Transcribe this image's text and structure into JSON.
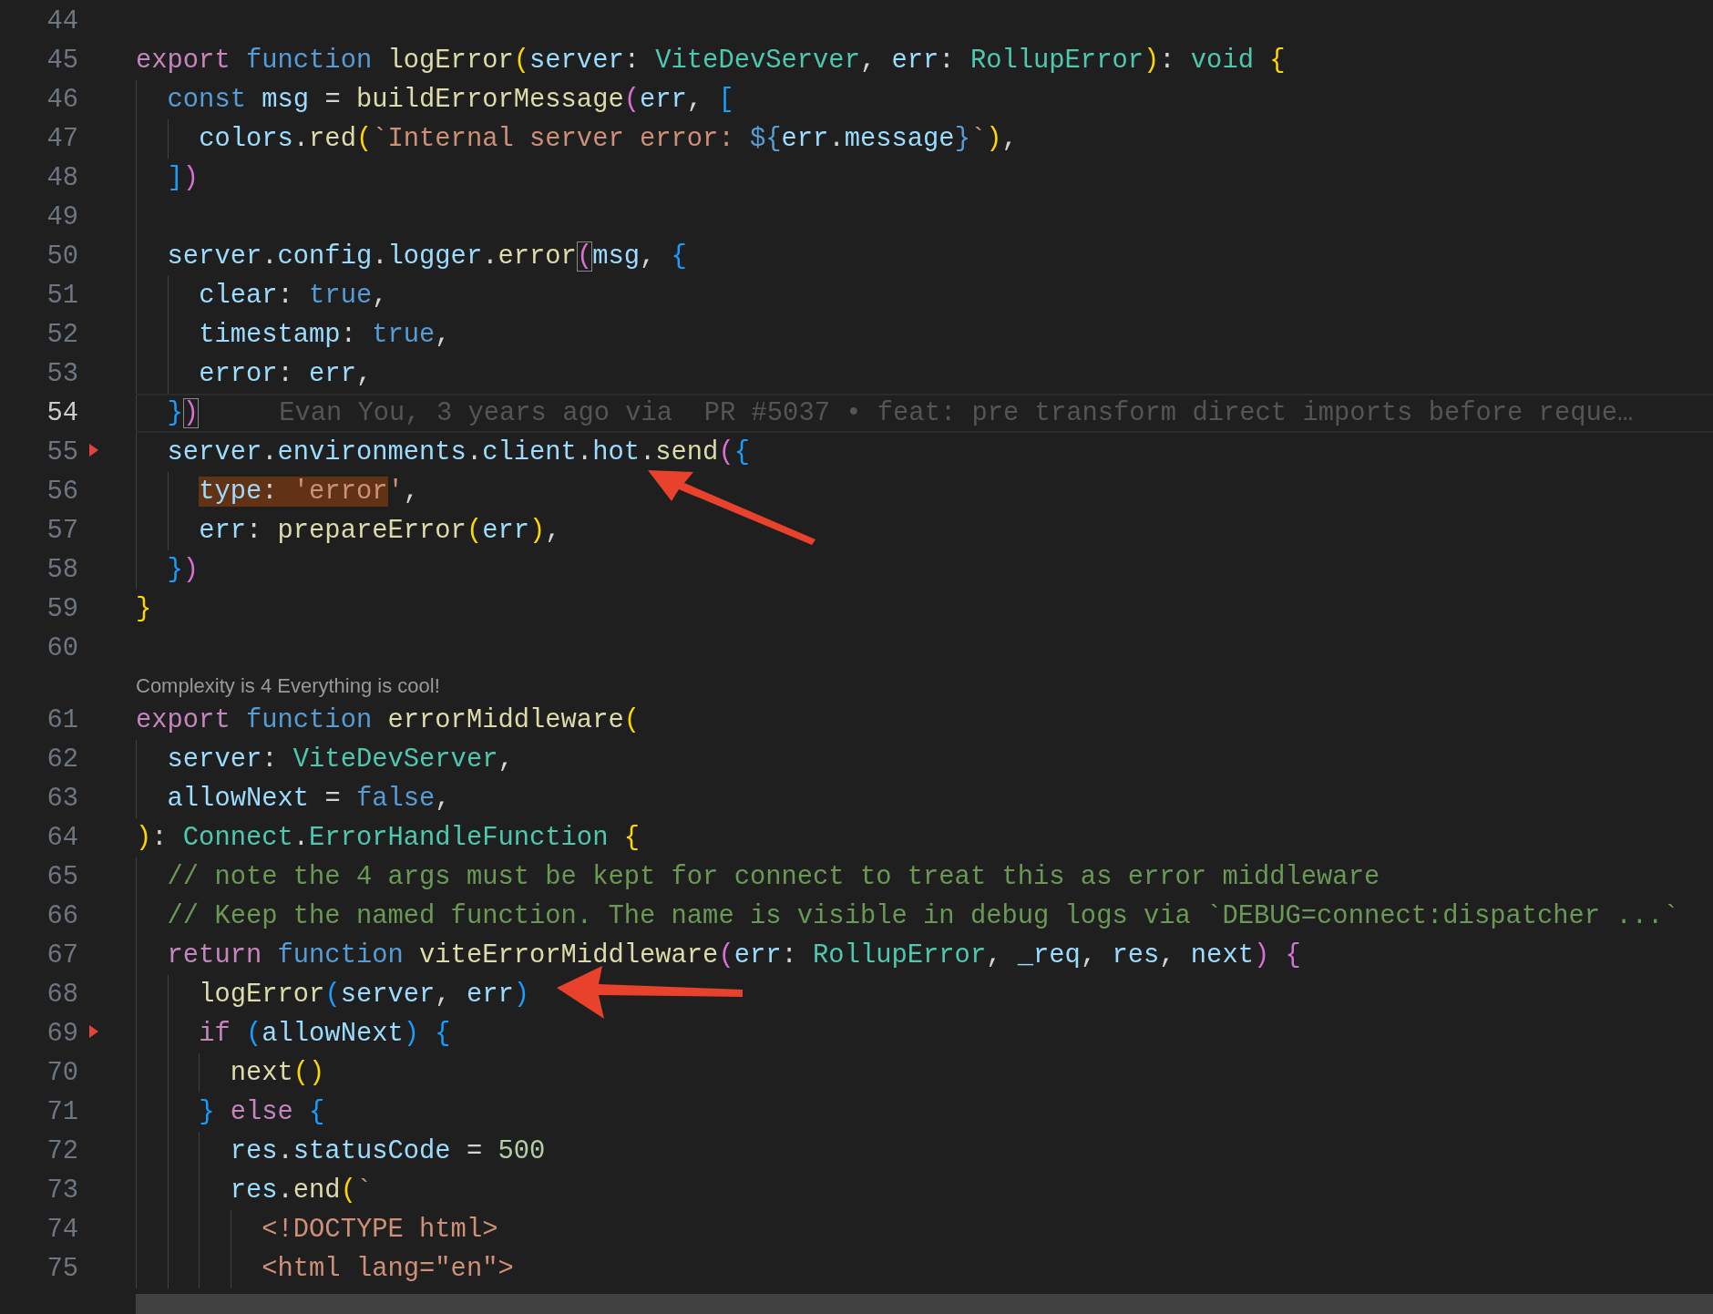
{
  "editor": {
    "lines": [
      {
        "number": "44",
        "current": false,
        "marker": false
      },
      {
        "number": "45",
        "current": false,
        "marker": false,
        "tokens": [
          {
            "kind": "keyword",
            "text": "export "
          },
          {
            "kind": "storage",
            "text": "function "
          },
          {
            "kind": "fn",
            "text": "logError"
          },
          {
            "kind": "b1",
            "text": "("
          },
          {
            "kind": "var",
            "text": "server"
          },
          {
            "kind": "plain",
            "text": ": "
          },
          {
            "kind": "type",
            "text": "ViteDevServer"
          },
          {
            "kind": "plain",
            "text": ", "
          },
          {
            "kind": "var",
            "text": "err"
          },
          {
            "kind": "plain",
            "text": ": "
          },
          {
            "kind": "type",
            "text": "RollupError"
          },
          {
            "kind": "b1",
            "text": ")"
          },
          {
            "kind": "plain",
            "text": ": "
          },
          {
            "kind": "type",
            "text": "void "
          },
          {
            "kind": "b1",
            "text": "{"
          }
        ]
      },
      {
        "number": "46",
        "current": false,
        "marker": false,
        "tokens": [
          {
            "kind": "storage",
            "text": "  const "
          },
          {
            "kind": "var",
            "text": "msg"
          },
          {
            "kind": "plain",
            "text": " = "
          },
          {
            "kind": "fn",
            "text": "buildErrorMessage"
          },
          {
            "kind": "b2",
            "text": "("
          },
          {
            "kind": "var",
            "text": "err"
          },
          {
            "kind": "plain",
            "text": ", "
          },
          {
            "kind": "b3",
            "text": "["
          }
        ]
      },
      {
        "number": "47",
        "current": false,
        "marker": false,
        "tokens": [
          {
            "kind": "var",
            "text": "    colors"
          },
          {
            "kind": "plain",
            "text": "."
          },
          {
            "kind": "fn",
            "text": "red"
          },
          {
            "kind": "b1",
            "text": "("
          },
          {
            "kind": "str",
            "text": "`Internal server error: "
          },
          {
            "kind": "storage",
            "text": "${"
          },
          {
            "kind": "var",
            "text": "err"
          },
          {
            "kind": "plain",
            "text": "."
          },
          {
            "kind": "var",
            "text": "message"
          },
          {
            "kind": "storage",
            "text": "}"
          },
          {
            "kind": "str",
            "text": "`"
          },
          {
            "kind": "b1",
            "text": ")"
          },
          {
            "kind": "plain",
            "text": ","
          }
        ]
      },
      {
        "number": "48",
        "current": false,
        "marker": false,
        "tokens": [
          {
            "kind": "b3",
            "text": "  ]"
          },
          {
            "kind": "b2",
            "text": ")"
          }
        ]
      },
      {
        "number": "49",
        "current": false,
        "marker": false
      },
      {
        "number": "50",
        "current": false,
        "marker": false,
        "tokens": [
          {
            "kind": "var",
            "text": "  server"
          },
          {
            "kind": "plain",
            "text": "."
          },
          {
            "kind": "var",
            "text": "config"
          },
          {
            "kind": "plain",
            "text": "."
          },
          {
            "kind": "var",
            "text": "logger"
          },
          {
            "kind": "plain",
            "text": "."
          },
          {
            "kind": "fn",
            "text": "error"
          },
          {
            "kind": "b2",
            "text": "(",
            "bracket_match": true
          },
          {
            "kind": "var",
            "text": "msg"
          },
          {
            "kind": "plain",
            "text": ", "
          },
          {
            "kind": "b3",
            "text": "{"
          }
        ]
      },
      {
        "number": "51",
        "current": false,
        "marker": false,
        "tokens": [
          {
            "kind": "var",
            "text": "    clear"
          },
          {
            "kind": "plain",
            "text": ": "
          },
          {
            "kind": "storage",
            "text": "true"
          },
          {
            "kind": "plain",
            "text": ","
          }
        ]
      },
      {
        "number": "52",
        "current": false,
        "marker": false,
        "tokens": [
          {
            "kind": "var",
            "text": "    timestamp"
          },
          {
            "kind": "plain",
            "text": ": "
          },
          {
            "kind": "storage",
            "text": "true"
          },
          {
            "kind": "plain",
            "text": ","
          }
        ]
      },
      {
        "number": "53",
        "current": false,
        "marker": false,
        "tokens": [
          {
            "kind": "var",
            "text": "    error"
          },
          {
            "kind": "plain",
            "text": ": "
          },
          {
            "kind": "var",
            "text": "err"
          },
          {
            "kind": "plain",
            "text": ","
          }
        ]
      },
      {
        "number": "54",
        "current": true,
        "marker": false,
        "blame": "Evan You, 3 years ago via  PR #5037 • feat: pre transform direct imports before reque…",
        "tokens": [
          {
            "kind": "b3",
            "text": "  }"
          },
          {
            "kind": "b2",
            "text": ")",
            "bracket_match": true
          }
        ]
      },
      {
        "number": "55",
        "current": false,
        "marker": true,
        "tokens": [
          {
            "kind": "var",
            "text": "  server"
          },
          {
            "kind": "plain",
            "text": "."
          },
          {
            "kind": "var",
            "text": "environments"
          },
          {
            "kind": "plain",
            "text": "."
          },
          {
            "kind": "var",
            "text": "client"
          },
          {
            "kind": "plain",
            "text": "."
          },
          {
            "kind": "var",
            "text": "hot"
          },
          {
            "kind": "plain",
            "text": "."
          },
          {
            "kind": "fn",
            "text": "send"
          },
          {
            "kind": "b2",
            "text": "("
          },
          {
            "kind": "b3",
            "text": "{"
          }
        ]
      },
      {
        "number": "56",
        "current": false,
        "marker": false,
        "arrow": {
          "kind": "steep"
        },
        "tokens": [
          {
            "kind": "var",
            "text": "    type",
            "find_match": true
          },
          {
            "kind": "plain",
            "text": ": ",
            "find_match": true
          },
          {
            "kind": "str",
            "text": "'error",
            "find_match": true
          },
          {
            "kind": "str",
            "text": "'"
          },
          {
            "kind": "plain",
            "text": ","
          }
        ]
      },
      {
        "number": "57",
        "current": false,
        "marker": false,
        "tokens": [
          {
            "kind": "var",
            "text": "    err"
          },
          {
            "kind": "plain",
            "text": ": "
          },
          {
            "kind": "fn",
            "text": "prepareError"
          },
          {
            "kind": "b1",
            "text": "("
          },
          {
            "kind": "var",
            "text": "err"
          },
          {
            "kind": "b1",
            "text": ")"
          },
          {
            "kind": "plain",
            "text": ","
          }
        ]
      },
      {
        "number": "58",
        "current": false,
        "marker": false,
        "tokens": [
          {
            "kind": "b3",
            "text": "  }"
          },
          {
            "kind": "b2",
            "text": ")"
          }
        ]
      },
      {
        "number": "59",
        "current": false,
        "marker": false,
        "tokens": [
          {
            "kind": "b1",
            "text": "}"
          }
        ]
      },
      {
        "number": "60",
        "current": false,
        "marker": false
      },
      {
        "number": "61",
        "current": false,
        "marker": false,
        "codelens": "Complexity is 4 Everything is cool!",
        "tokens": [
          {
            "kind": "keyword",
            "text": "export "
          },
          {
            "kind": "storage",
            "text": "function "
          },
          {
            "kind": "fn",
            "text": "errorMiddleware"
          },
          {
            "kind": "b1",
            "text": "("
          }
        ]
      },
      {
        "number": "62",
        "current": false,
        "marker": false,
        "tokens": [
          {
            "kind": "var",
            "text": "  server"
          },
          {
            "kind": "plain",
            "text": ": "
          },
          {
            "kind": "type",
            "text": "ViteDevServer"
          },
          {
            "kind": "plain",
            "text": ","
          }
        ]
      },
      {
        "number": "63",
        "current": false,
        "marker": false,
        "tokens": [
          {
            "kind": "var",
            "text": "  allowNext"
          },
          {
            "kind": "plain",
            "text": " = "
          },
          {
            "kind": "storage",
            "text": "false"
          },
          {
            "kind": "plain",
            "text": ","
          }
        ]
      },
      {
        "number": "64",
        "current": false,
        "marker": false,
        "tokens": [
          {
            "kind": "b1",
            "text": ")"
          },
          {
            "kind": "plain",
            "text": ": "
          },
          {
            "kind": "type",
            "text": "Connect"
          },
          {
            "kind": "plain",
            "text": "."
          },
          {
            "kind": "type",
            "text": "ErrorHandleFunction "
          },
          {
            "kind": "b1",
            "text": "{"
          }
        ]
      },
      {
        "number": "65",
        "current": false,
        "marker": false,
        "tokens": [
          {
            "kind": "comment",
            "text": "  // note the 4 args must be kept for connect to treat this as error middleware"
          }
        ]
      },
      {
        "number": "66",
        "current": false,
        "marker": false,
        "tokens": [
          {
            "kind": "comment",
            "text": "  // Keep the named function. The name is visible in debug logs via `DEBUG=connect:dispatcher ...`"
          }
        ]
      },
      {
        "number": "67",
        "current": false,
        "marker": false,
        "tokens": [
          {
            "kind": "keyword",
            "text": "  return "
          },
          {
            "kind": "storage",
            "text": "function "
          },
          {
            "kind": "fn",
            "text": "viteErrorMiddleware"
          },
          {
            "kind": "b2",
            "text": "("
          },
          {
            "kind": "var",
            "text": "err"
          },
          {
            "kind": "plain",
            "text": ": "
          },
          {
            "kind": "type",
            "text": "RollupError"
          },
          {
            "kind": "plain",
            "text": ", "
          },
          {
            "kind": "var",
            "text": "_req"
          },
          {
            "kind": "plain",
            "text": ", "
          },
          {
            "kind": "var",
            "text": "res"
          },
          {
            "kind": "plain",
            "text": ", "
          },
          {
            "kind": "var",
            "text": "next"
          },
          {
            "kind": "b2",
            "text": ") "
          },
          {
            "kind": "b2",
            "text": "{"
          }
        ]
      },
      {
        "number": "68",
        "current": false,
        "marker": false,
        "arrow": {
          "kind": "flat"
        },
        "tokens": [
          {
            "kind": "fn",
            "text": "    logError"
          },
          {
            "kind": "b3",
            "text": "("
          },
          {
            "kind": "var",
            "text": "server"
          },
          {
            "kind": "plain",
            "text": ", "
          },
          {
            "kind": "var",
            "text": "err"
          },
          {
            "kind": "b3",
            "text": ")"
          }
        ]
      },
      {
        "number": "69",
        "current": false,
        "marker": true,
        "tokens": [
          {
            "kind": "keyword",
            "text": "    if "
          },
          {
            "kind": "b3",
            "text": "("
          },
          {
            "kind": "var",
            "text": "allowNext"
          },
          {
            "kind": "b3",
            "text": ") "
          },
          {
            "kind": "b3",
            "text": "{"
          }
        ]
      },
      {
        "number": "70",
        "current": false,
        "marker": false,
        "tokens": [
          {
            "kind": "fn",
            "text": "      next"
          },
          {
            "kind": "b1",
            "text": "()"
          }
        ]
      },
      {
        "number": "71",
        "current": false,
        "marker": false,
        "tokens": [
          {
            "kind": "b3",
            "text": "    } "
          },
          {
            "kind": "keyword",
            "text": "else "
          },
          {
            "kind": "b3",
            "text": "{"
          }
        ]
      },
      {
        "number": "72",
        "current": false,
        "marker": false,
        "tokens": [
          {
            "kind": "var",
            "text": "      res"
          },
          {
            "kind": "plain",
            "text": "."
          },
          {
            "kind": "var",
            "text": "statusCode"
          },
          {
            "kind": "plain",
            "text": " = "
          },
          {
            "kind": "num",
            "text": "500"
          }
        ]
      },
      {
        "number": "73",
        "current": false,
        "marker": false,
        "tokens": [
          {
            "kind": "var",
            "text": "      res"
          },
          {
            "kind": "plain",
            "text": "."
          },
          {
            "kind": "fn",
            "text": "end"
          },
          {
            "kind": "b1",
            "text": "("
          },
          {
            "kind": "str",
            "text": "`"
          }
        ]
      },
      {
        "number": "74",
        "current": false,
        "marker": false,
        "tokens": [
          {
            "kind": "str",
            "text": "        <!DOCTYPE html>"
          }
        ]
      },
      {
        "number": "75",
        "current": false,
        "marker": false,
        "tokens": [
          {
            "kind": "str",
            "text": "        <html lang=\"en\">"
          }
        ]
      }
    ]
  }
}
